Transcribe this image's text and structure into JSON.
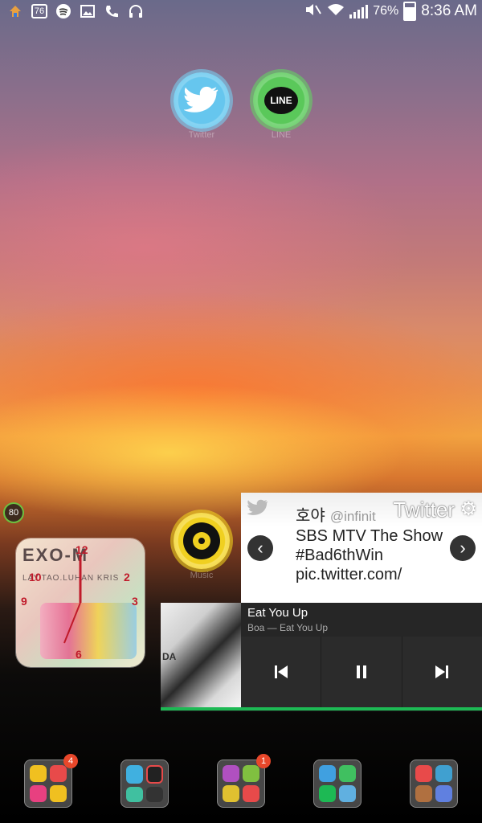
{
  "status_bar": {
    "time": "8:36 AM",
    "battery_percent": "76%",
    "battery_level": 0.76,
    "notification_badge": "76",
    "left_icons": [
      "home-icon",
      "notification-76-icon",
      "spotify-icon",
      "gallery-icon",
      "phone-icon",
      "headphones-icon"
    ],
    "right_icons": [
      "mute-icon",
      "wifi-icon",
      "signal-icon",
      "battery-icon"
    ]
  },
  "home": {
    "apps": [
      {
        "label": "Twitter"
      },
      {
        "label": "LINE"
      },
      {
        "label": "Music"
      }
    ],
    "line_logo_text": "LINE",
    "battery_widget": "80"
  },
  "clock_widget": {
    "title": "EXO-M",
    "subtitle": "LAY.TAO.LUHAN KRIS",
    "numbers": [
      "12",
      "2",
      "3",
      "6",
      "9",
      "10"
    ]
  },
  "twitter_widget": {
    "title": "Twitter",
    "user_name": "호야",
    "user_handle": "@infinit",
    "tweet_text": "SBS MTV The Show #Bad6thWin pic.twitter.com/"
  },
  "music_widget": {
    "track_title": "Eat You Up",
    "track_subtitle": "Boa — Eat You Up",
    "art_text": "DA",
    "progress": 1.0,
    "accent_color": "#1db954"
  },
  "dock": {
    "folders": [
      {
        "badge": "4"
      },
      {
        "badge": ""
      },
      {
        "badge": "1"
      },
      {
        "badge": ""
      },
      {
        "badge": ""
      }
    ]
  }
}
